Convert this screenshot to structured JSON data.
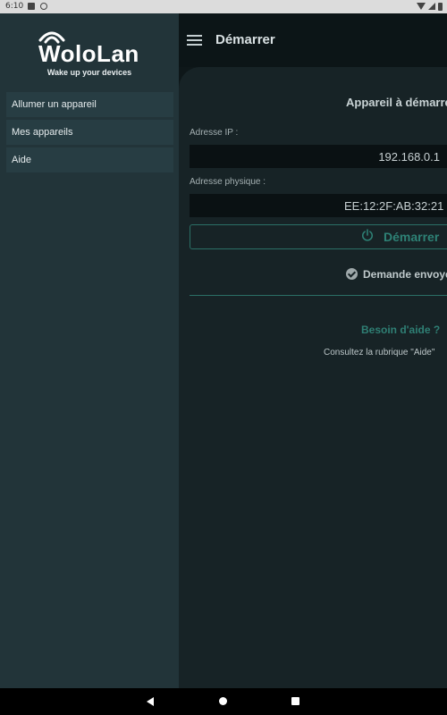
{
  "status_bar": {
    "time": "6:10"
  },
  "app": {
    "title": "Démarrer",
    "card_title": "Appareil à démarrer",
    "ip_label": "Adresse IP :",
    "ip_value": "192.168.0.1",
    "mac_label": "Adresse physique :",
    "mac_value": "EE:12:2F:AB:32:21",
    "start_button": "Démarrer",
    "sent_status": "Demande envoyée",
    "help_title": "Besoin d'aide ?",
    "help_text": "Consultez la rubrique \"Aide\""
  },
  "drawer": {
    "logo_text": "WoloLan",
    "tagline": "Wake up your devices",
    "items": [
      {
        "label": "Allumer un appareil"
      },
      {
        "label": "Mes appareils"
      },
      {
        "label": "Aide"
      }
    ]
  },
  "colors": {
    "drawer_bg": "#223439",
    "nav_item_bg": "#273d43",
    "accent": "#2e8276",
    "card_bg": "#172326"
  }
}
